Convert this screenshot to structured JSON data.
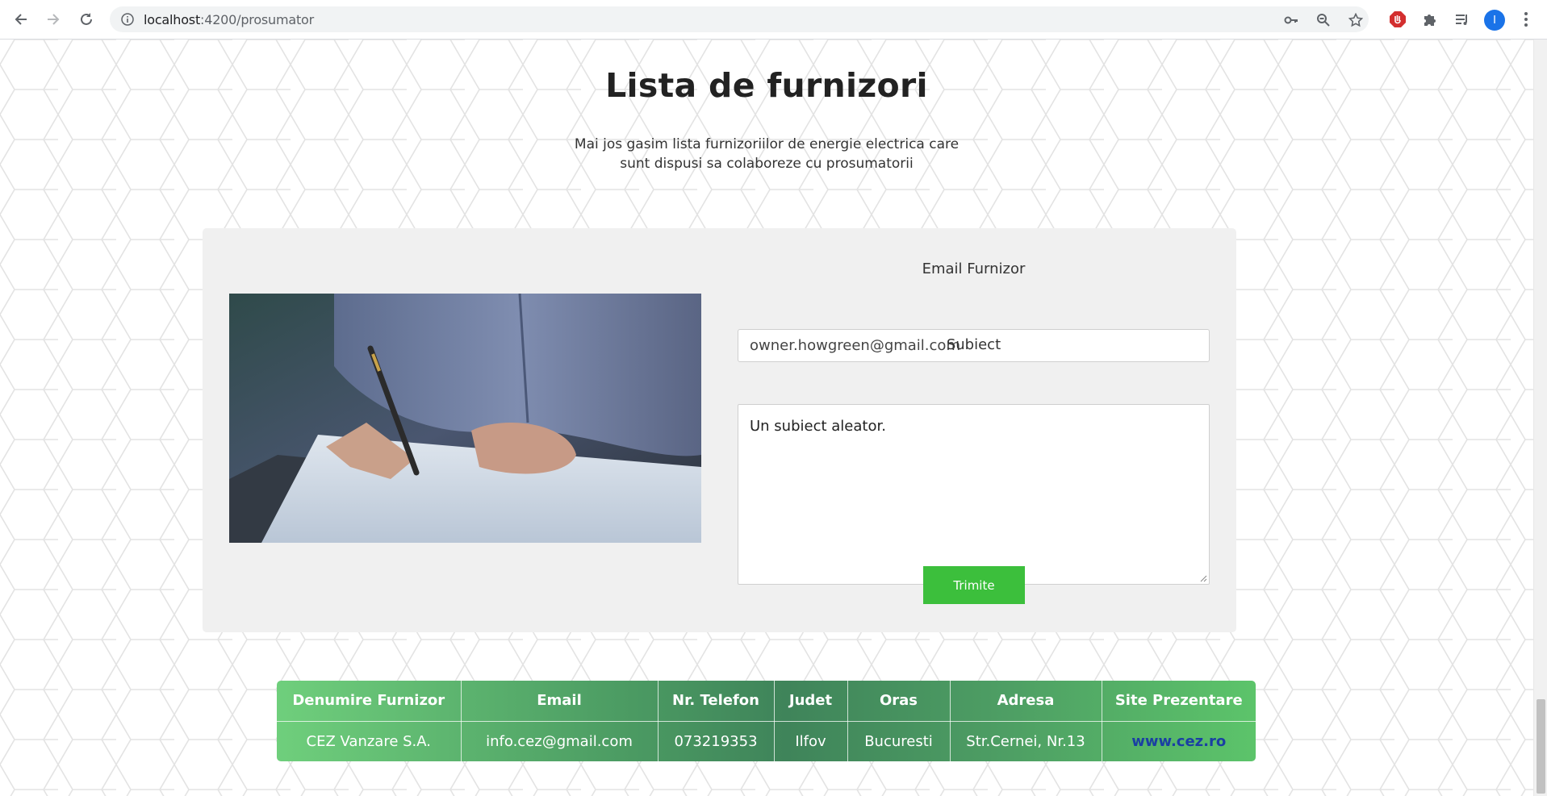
{
  "browser": {
    "url_host": "localhost",
    "url_path": ":4200/prosumator",
    "avatar_letter": "I"
  },
  "page": {
    "title": "Lista de furnizori",
    "subtitle_line1": "Mai jos gasim lista furnizoriilor de energie electrica care",
    "subtitle_line2": "sunt dispusi sa colaboreze cu prosumatorii"
  },
  "form": {
    "email_label": "Email Furnizor",
    "email_value": "owner.howgreen@gmail.com",
    "subject_label": "Subiect",
    "subject_value": "Un subiect aleator.",
    "send_label": "Trimite"
  },
  "table": {
    "headers": [
      "Denumire Furnizor",
      "Email",
      "Nr. Telefon",
      "Judet",
      "Oras",
      "Adresa",
      "Site Prezentare"
    ],
    "rows": [
      [
        "CEZ Vanzare S.A.",
        "info.cez@gmail.com",
        "073219353",
        "Ilfov",
        "Bucuresti",
        "Str.Cernei, Nr.13",
        "www.cez.ro"
      ]
    ]
  },
  "colors": {
    "send_button": "#3cbf3c",
    "table_gradient_start": "#6fcf7c",
    "table_gradient_end": "#5cc46a",
    "link": "#1a3fa3"
  }
}
